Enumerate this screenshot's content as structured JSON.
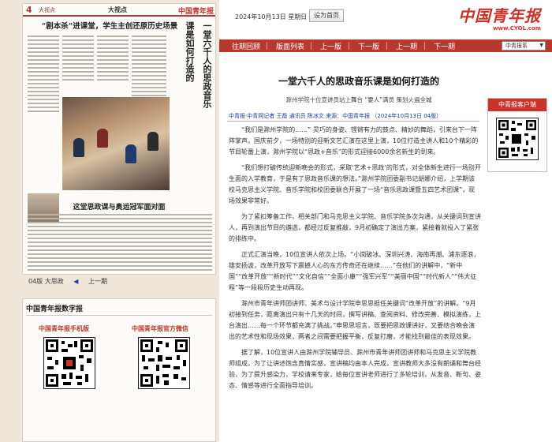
{
  "newspaper": {
    "page_num": "4",
    "section": "大视点",
    "page_title": "大视点",
    "logo": "中国青年报",
    "headline": "“剧本杀”进课堂，学生主创还原历史场景",
    "vertical_headline_1": "一堂六千人的思政音乐",
    "vertical_headline_2": "课是如何打造的",
    "lower_headline": "这堂思政课与奥运冠军面对面",
    "nav": {
      "current": "04版 大思政",
      "prev": "上一期"
    }
  },
  "lower_panel": {
    "heading": "中国青年报数字报",
    "qr1_title": "中国青年报手机版",
    "qr2_title": "中国青年报官方微信"
  },
  "header": {
    "date": "2024年10月13日 星期日",
    "home_button": "设为首页",
    "logo": "中国青年报",
    "logo_url": "www.CYOL.com"
  },
  "nav": {
    "items": [
      "往期回顾",
      "版面列表",
      "上一版",
      "下一版",
      "上一期",
      "下一期"
    ],
    "select_value": "中青报系"
  },
  "article": {
    "title": "一堂六千人的思政音乐课是如何打造的",
    "subtitle": "滁州学院十位宣讲员站上舞台 “要人”满员 策划火遍全城",
    "meta": "中青报·中青网记者 王磊 通讯员 陈冰文  来源：中国青年报  （2024年10月13日  04版）",
    "paragraphs": [
      "“我们是滁州学院的……” 灵巧的身姿、铿锵有力的鼓点、精妙的舞蹈，引来台下一阵阵掌声。国庆前夕，一场特别的迎新文艺汇演在这里上演，10位打造主讲人和10个精彩的节目轮番上演，滁州学院以“思政+音乐”的形式迎接6000余名新生的到来。",
      "“我们想打破传统迎新晚会的形式，采取‘艺术+思政’的形式，对全体新生进行一场别开生面的入学教育，于是有了思政音乐课的想法。”滁州学院团委副书记胡娜介绍，上学期该校马克思主义学院、音乐学院和校团委联合开展了一场“音乐思政课暨五四艺术团课”，现场效果非常好。",
      "为了紧扣筹备工作，相关部门和马克思主义学院、音乐学院多次沟通，从关键词到宣讲人，再到演出节目的遴选，都经过反复推敲，9月初确定了演出方案，紧接着就投入了紧张的排练中。",
      "正式汇演当晚，10位宣讲人依次上场。“小岗破冰、深圳兴涛、海南再潮、浦东逐浪，雄安扬波，改革开放写下震撼人心的东方传奇还在继续……”在他们的讲解中，“新中国”“改革开放”“新时代”“文化自信”“全面小康”“强军兴军”“美丽中国”“时代新人”“伟大征程”等一段段历史生动再现。",
      "滁州市青年讲师团讲师、美术与设计学院申思思担任关键词“改革开放”的讲解。“9月初接到任务，距离演出只有十几天的时间，撰写讲稿、查阅资料、修改完善、模拟演练，上台演出……每一个环节都充满了挑战。”申思思坦言，既要把思政课讲好，又要结合晚会演出的艺术性和现场效果，两者之间需要把握平衡，反复打磨，才能找到最佳的表现效果。",
      "据了解，10位宣讲人由滁州学院辅导员、滁州市青年讲师团讲师和马克思主义学院教师组成，为了让讲述饱含真情实感，宣讲稿均由本人完成，宣讲教师大多没有朗诵和舞台经验，为了提升感染力，学校请来专家，给每位宣讲老师进行了多轮培训，从发音、断句、姿态、情感等进行全面指导培训。"
    ]
  },
  "side": {
    "header": "中青报客户端"
  }
}
